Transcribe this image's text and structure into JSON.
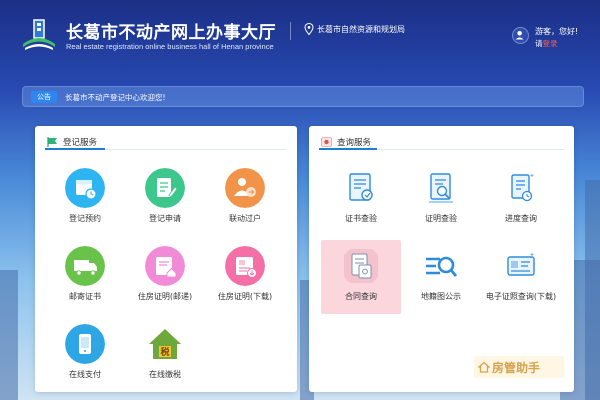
{
  "header": {
    "title": "长葛市不动产网上办事大厅",
    "subtitle": "Real estate registration online business hall of Henan province",
    "agency": "长葛市自然资源和规划局",
    "greeting": "游客，您好!",
    "login_prefix": "请",
    "login_link": "登录"
  },
  "notice": {
    "tag": "公告",
    "text": "长葛市不动产登记中心欢迎您!"
  },
  "registration": {
    "title": "登记服务",
    "items": [
      {
        "label": "登记预约",
        "icon": "calendar-clock-icon",
        "color": "#2eb4f0"
      },
      {
        "label": "登记申请",
        "icon": "form-edit-icon",
        "color": "#3ec78d"
      },
      {
        "label": "联动过户",
        "icon": "user-transfer-icon",
        "color": "#f2934a"
      },
      {
        "label": "邮寄证书",
        "icon": "delivery-truck-icon",
        "color": "#69c34a"
      },
      {
        "label": "住房证明(邮递)",
        "icon": "house-certificate-mail-icon",
        "color": "#f18bd8"
      },
      {
        "label": "住房证明(下载)",
        "icon": "house-certificate-download-icon",
        "color": "#f36fa6"
      },
      {
        "label": "在线支付",
        "icon": "online-payment-icon",
        "color": "#2ea6e4"
      },
      {
        "label": "在线缴税",
        "icon": "tax-house-icon",
        "color": "#7fb340"
      }
    ]
  },
  "query": {
    "title": "查询服务",
    "items": [
      {
        "label": "证书查验",
        "icon": "certificate-verify-icon"
      },
      {
        "label": "证明查验",
        "icon": "document-search-icon"
      },
      {
        "label": "进度查询",
        "icon": "progress-document-icon"
      },
      {
        "label": "合同查询",
        "icon": "contract-query-icon"
      },
      {
        "label": "地籍图公示",
        "icon": "map-search-icon"
      },
      {
        "label": "电子证照查询(下载)",
        "icon": "e-license-card-icon"
      }
    ]
  },
  "watermark": {
    "text": "房管助手",
    "icon": "house-logo-icon"
  },
  "colors": {
    "accent": "#1b7fd6",
    "header_bg": "#1c2f86",
    "login_link": "#ff5a4a",
    "highlight": "#fbd6dd"
  }
}
